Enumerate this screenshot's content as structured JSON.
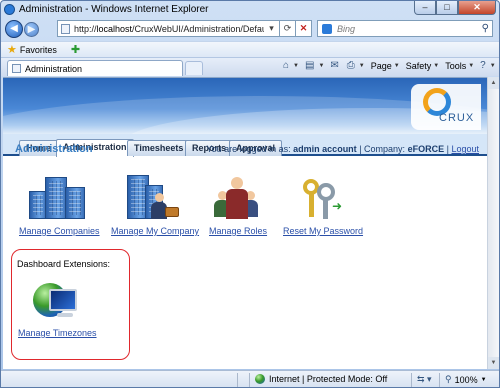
{
  "window": {
    "title": "Administration - Windows Internet Explorer",
    "minimize_label": "–",
    "maximize_label": "□",
    "close_label": "✕"
  },
  "address_bar": {
    "url_prefix": "http://",
    "url_host": "localhost",
    "url_path": "/CruxWebUI/Administration/Default.aspx",
    "search_placeholder": "Bing",
    "refresh_glyph": "⟳",
    "stop_glyph": "✕",
    "compat_glyph": "▾"
  },
  "favorites_bar": {
    "favorites_label": "Favorites"
  },
  "browser_tab": {
    "label": "Administration"
  },
  "command_bar": {
    "page_label": "Page",
    "safety_label": "Safety",
    "tools_label": "Tools",
    "help_glyph": "?",
    "home_glyph": "⌂",
    "feeds_glyph": "▤",
    "mail_glyph": "✉",
    "print_glyph": "⎙",
    "more_glyph": "»"
  },
  "app": {
    "logo_text": "CRUX",
    "menu_tabs": [
      {
        "label": "Home",
        "active": false
      },
      {
        "label": "Administration",
        "active": true
      },
      {
        "label": "Timesheets",
        "active": false
      },
      {
        "label": "Reports",
        "active": false
      },
      {
        "label": "Approval",
        "active": false
      }
    ],
    "page_title": "Administration",
    "login": {
      "prefix": "You are logged in as:",
      "user": "admin account",
      "company_prefix": "| Company:",
      "company": "eFORCE",
      "separator": "|",
      "logout": "Logout"
    },
    "tiles": [
      {
        "label": "Manage Companies",
        "icon": "buildings-icon"
      },
      {
        "label": "Manage My Company",
        "icon": "company-person-icon"
      },
      {
        "label": "Manage Roles",
        "icon": "people-icon"
      },
      {
        "label": "Reset My Password",
        "icon": "keys-icon"
      }
    ],
    "dashboard": {
      "title": "Dashboard Extensions:",
      "link": "Manage Timezones",
      "icon": "globe-monitor-icon"
    }
  },
  "status_bar": {
    "zone_text": "Internet | Protected Mode: Off",
    "zoom": "100%"
  },
  "colors": {
    "link": "#2a4fa8",
    "page_title": "#3a7ec2",
    "highlight_box": "#e0282d",
    "logo_orange": "#f2a21a",
    "logo_blue": "#2d86d8"
  }
}
